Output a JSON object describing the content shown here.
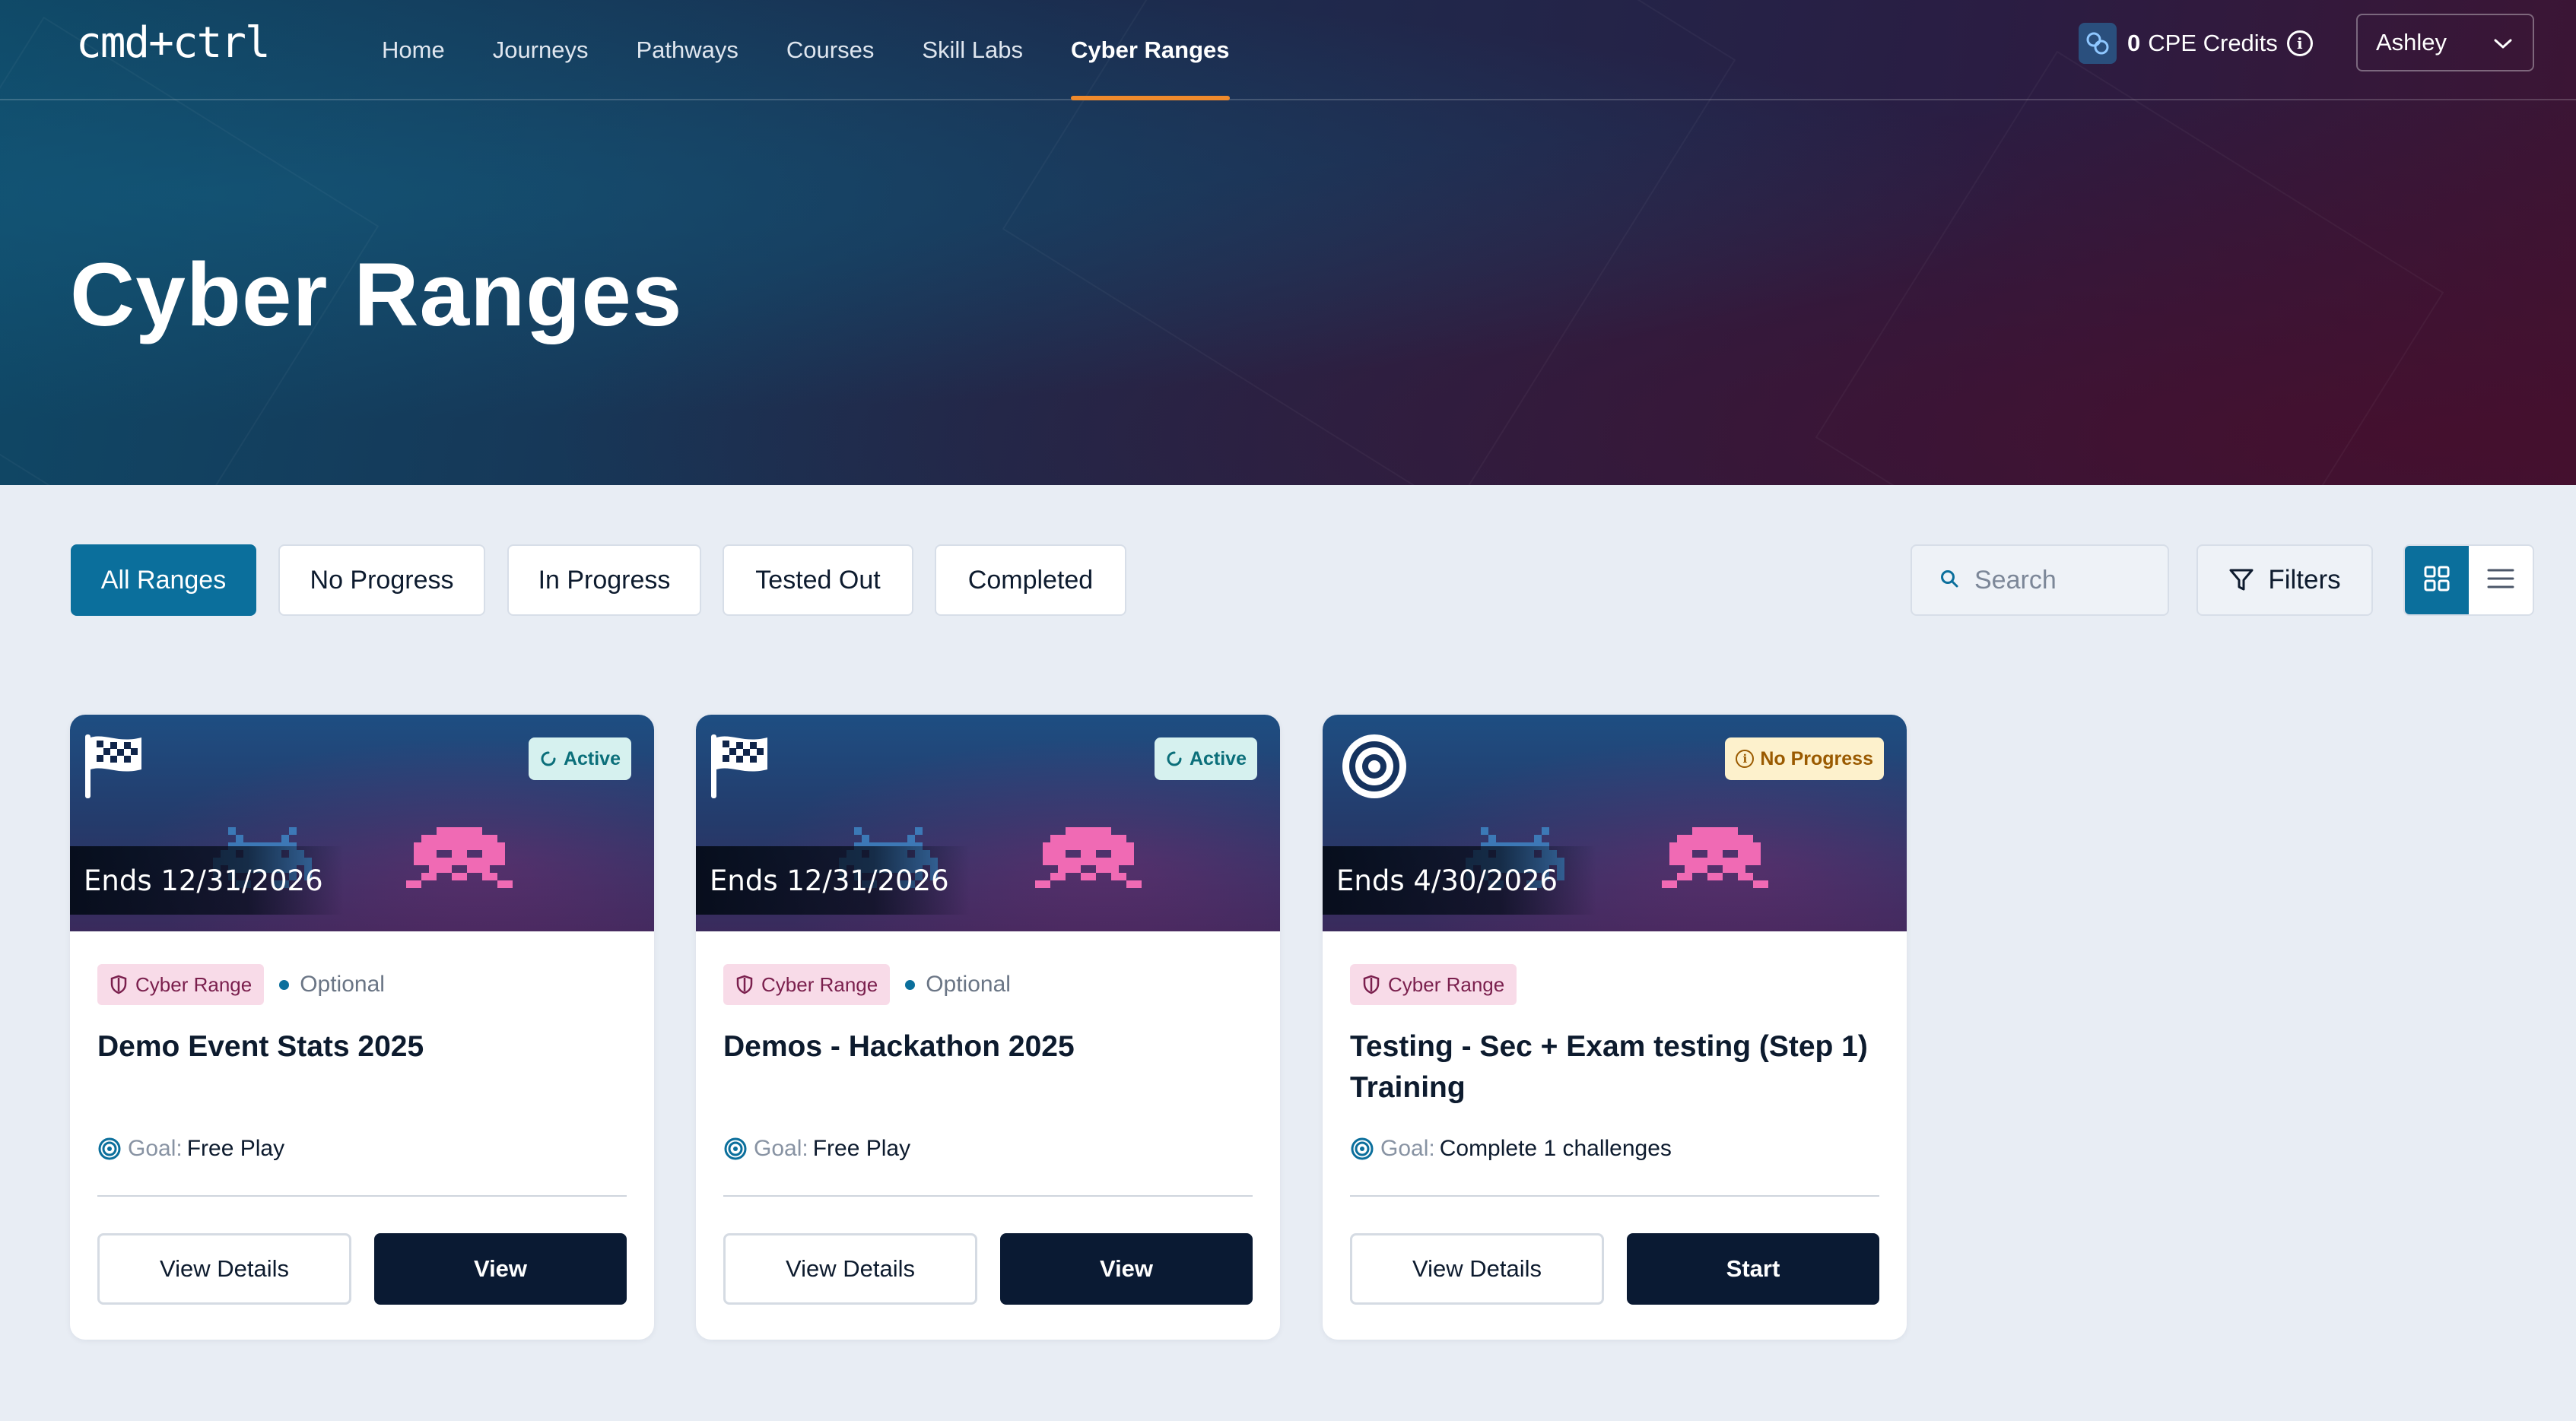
{
  "header": {
    "logo": "cmd+ctrl",
    "nav": [
      "Home",
      "Journeys",
      "Pathways",
      "Courses",
      "Skill Labs",
      "Cyber Ranges"
    ],
    "active_nav": "Cyber Ranges",
    "credits_count": "0",
    "credits_label": "CPE Credits",
    "user_name": "Ashley"
  },
  "hero": {
    "title": "Cyber Ranges"
  },
  "tabs": [
    "All Ranges",
    "No Progress",
    "In Progress",
    "Tested Out",
    "Completed"
  ],
  "active_tab": "All Ranges",
  "search": {
    "placeholder": "Search"
  },
  "filters_label": "Filters",
  "view_mode": "grid",
  "cards": [
    {
      "icon": "checkered-flag-icon",
      "status": "Active",
      "ends": "Ends 12/31/2026",
      "type": "Cyber Range",
      "optional": "Optional",
      "title": "Demo Event Stats 2025",
      "goal_label": "Goal:",
      "goal_value": "Free Play",
      "details_label": "View Details",
      "action_label": "View"
    },
    {
      "icon": "checkered-flag-icon",
      "status": "Active",
      "ends": "Ends 12/31/2026",
      "type": "Cyber Range",
      "optional": "Optional",
      "title": "Demos - Hackathon 2025",
      "goal_label": "Goal:",
      "goal_value": "Free Play",
      "details_label": "View Details",
      "action_label": "View"
    },
    {
      "icon": "target-icon",
      "status": "No Progress",
      "ends": "Ends 4/30/2026",
      "type": "Cyber Range",
      "title": "Testing - Sec + Exam testing (Step 1) Training",
      "goal_label": "Goal:",
      "goal_value": "Complete 1 challenges",
      "details_label": "View Details",
      "action_label": "Start"
    }
  ],
  "colors": {
    "accent": "#0b6f9c",
    "nav_active_underline": "#ef8a2c",
    "primary_button": "#0a1a33",
    "type_badge_bg": "#f8dbe8",
    "active_badge_bg": "#d6f1ef",
    "no_progress_badge_bg": "#fdf1cc"
  }
}
